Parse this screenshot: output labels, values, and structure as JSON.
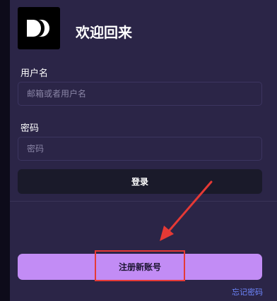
{
  "header": {
    "title": "欢迎回来"
  },
  "form": {
    "username_label": "用户名",
    "username_placeholder": "邮箱或者用户名",
    "password_label": "密码",
    "password_placeholder": "密码"
  },
  "actions": {
    "login_label": "登录",
    "register_label": "注册新账号",
    "forgot_label": "忘记密码"
  },
  "colors": {
    "panel_bg": "#2b2547",
    "register_accent": "#c28cf5",
    "highlight": "#e53935",
    "link": "#6f87ff"
  }
}
